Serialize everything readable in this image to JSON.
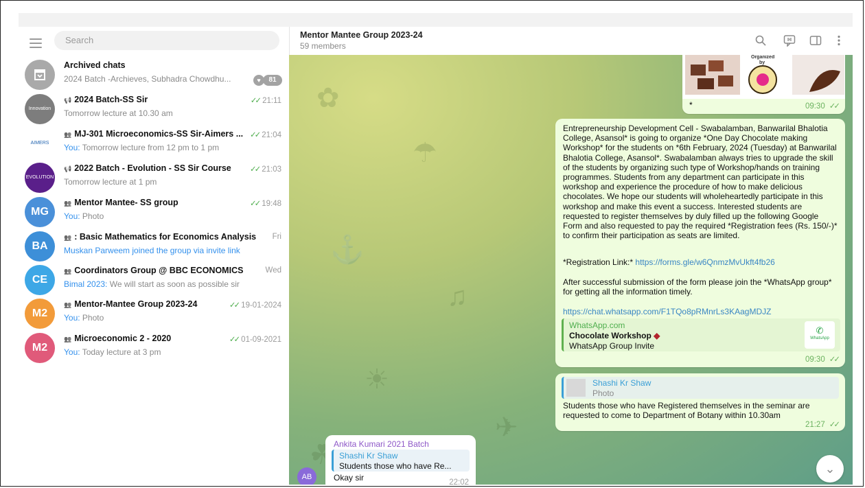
{
  "sidebar": {
    "search_placeholder": "Search",
    "chats": [
      {
        "name": "Archived chats",
        "preview": "2024 Batch -Archieves, Subhadra Chowdhu...",
        "badge": "81",
        "avatar_color": "#a9a9a9",
        "type": "archive"
      },
      {
        "name": "2024 Batch-SS Sir",
        "time": "21:11",
        "preview": "Tomorrow lecture at 10.30 am",
        "avatar_color": "#7d7d7d",
        "avatar_text": "Innovation",
        "type": "channel"
      },
      {
        "name": "MJ-301 Microeconomics-SS Sir-Aimers ...",
        "time": "21:04",
        "you": "You:",
        "preview": " Tomorrow lecture from 12 pm to 1 pm",
        "avatar_color": "#ffffff",
        "avatar_text": "AIMERS",
        "type": "group"
      },
      {
        "name": "2022 Batch - Evolution - SS Sir Course",
        "time": "21:03",
        "preview": "Tomorrow lecture at 1 pm",
        "avatar_color": "#5a1f8a",
        "avatar_text": "EVOLUTION",
        "type": "channel"
      },
      {
        "name": "Mentor Mantee- SS group",
        "time": "19:48",
        "you": "You:",
        "preview": " Photo",
        "avatar_color": "#4a90d9",
        "avatar_text": "MG",
        "type": "group"
      },
      {
        "name": ": Basic Mathematics for Economics Analysis",
        "time": "Fri",
        "preview_blue": "Muskan Parweem joined the group via invite link",
        "avatar_color": "#3d8fd8",
        "avatar_text": "BA",
        "type": "group"
      },
      {
        "name": "Coordinators Group @ BBC ECONOMICS",
        "time": "Wed",
        "you": "Bimal 2023:",
        "preview": " We will start as soon as possible sir",
        "avatar_color": "#3da7e6",
        "avatar_text": "CE",
        "type": "group"
      },
      {
        "name": "Mentor-Mantee Group 2023-24",
        "time": "19-01-2024",
        "you": "You:",
        "preview": " Photo",
        "avatar_color": "#f29b3a",
        "avatar_text": "M2",
        "type": "group"
      },
      {
        "name": "Microeconomic 2 - 2020",
        "time": "01-09-2021",
        "you": "You:",
        "preview": " Today lecture at 3 pm",
        "avatar_color": "#e05a7a",
        "avatar_text": "M2",
        "type": "group"
      }
    ]
  },
  "header": {
    "title": "Mentor Mantee Group 2023-24",
    "subtitle": "59 members"
  },
  "messages": {
    "photo_caption": "*",
    "photo_time": "09:30",
    "photo_label_organized": "Organized",
    "photo_label_by": "by",
    "workshop_paragraph": "Entrepreneurship Development Cell - Swabalamban, Banwarilal Bhalotia College, Asansol* is going to organize *One Day Chocolate making Workshop* for the students on *6th February, 2024 (Tuesday) at Banwarilal Bhalotia College, Asansol*. Swabalamban always tries to upgrade the skill of the students by organizing such type of Workshop/hands on training programmes. Students from any department can participate in this workshop and experience the procedure of how to make delicious chocolates. We hope our students will wholeheartedly participate in this workshop and make this event a success. Interested students are requested to register themselves by duly filled up the following Google Form and also requested to pay the required *Registration fees (Rs. 150/-)* to confirm their participation as seats are limited.",
    "registration_label": "*Registration Link:* ",
    "registration_link": "https://forms.gle/w6QnmzMvUkft4fb26",
    "after_text": "After successful submission of the form please join the *WhatsApp group* for getting all the information timely.",
    "whatsapp_link": "https://chat.whatsapp.com/F1TQo8pRMnrLs3KAagMDJZ",
    "preview_site": "WhatsApp.com",
    "preview_title": "Chocolate Workshop",
    "preview_desc": "WhatsApp Group Invite",
    "preview_thumb": "WhatsApp",
    "workshop_time": "09:30",
    "reply1_author": "Shashi Kr Shaw",
    "reply1_type": "Photo",
    "seminar_text": "Students those who have Registered themselves in the seminar are requested to come to Department of Botany within 10.30am",
    "seminar_time": "21:27",
    "incoming_sender": "Ankita Kumari 2021 Batch",
    "incoming_reply_author": "Shashi Kr Shaw",
    "incoming_reply_text": "Students those who have Re...",
    "incoming_text": "Okay sir",
    "incoming_time": "22:02",
    "incoming_avatar": "AB"
  },
  "colors": {
    "accent": "#3390ec",
    "outgoing_bubble": "#effdde",
    "tick_green": "#4fae4e"
  }
}
